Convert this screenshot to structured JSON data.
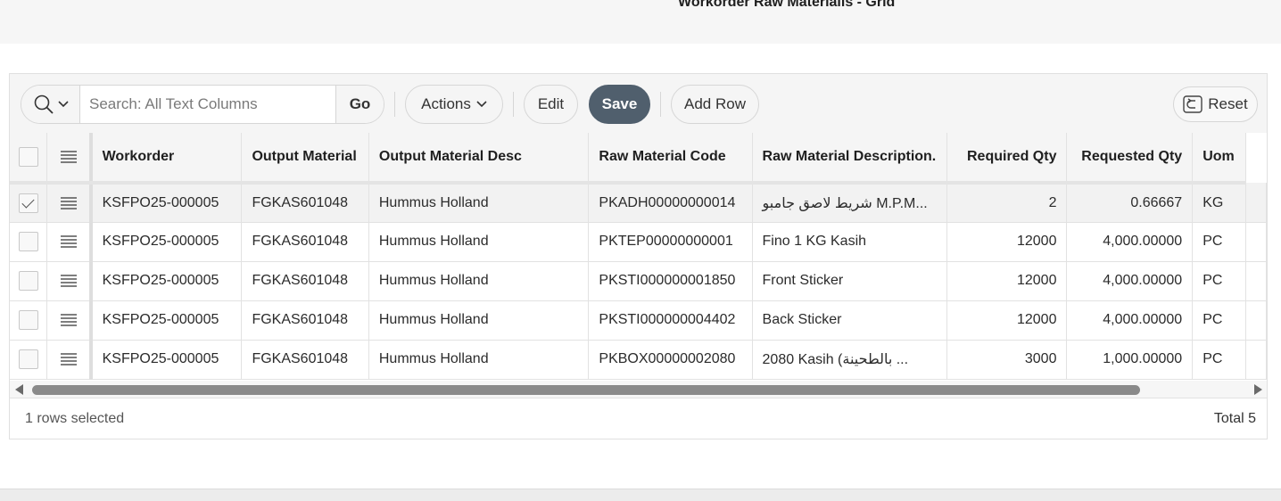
{
  "page": {
    "title": "Workorder Raw Materialis - Grid"
  },
  "toolbar": {
    "search_placeholder": "Search: All Text Columns",
    "go_label": "Go",
    "actions_label": "Actions",
    "edit_label": "Edit",
    "save_label": "Save",
    "add_row_label": "Add Row",
    "reset_label": "Reset"
  },
  "grid": {
    "columns": [
      "Workorder",
      "Output Material",
      "Output Material Desc",
      "Raw Material Code",
      "Raw Material Description.",
      "Required Qty",
      "Requested Qty",
      "Uom"
    ],
    "rows": [
      {
        "selected": true,
        "cells": [
          "KSFPO25-000005",
          "FGKAS601048",
          "Hummus Holland",
          "PKADH00000000014",
          "شريط لاصق جامبو M.P.M...",
          "2",
          "0.66667",
          "KG"
        ]
      },
      {
        "selected": false,
        "cells": [
          "KSFPO25-000005",
          "FGKAS601048",
          "Hummus Holland",
          "PKTEP00000000001",
          "Fino 1 KG Kasih",
          "12000",
          "4,000.00000",
          "PC"
        ]
      },
      {
        "selected": false,
        "cells": [
          "KSFPO25-000005",
          "FGKAS601048",
          "Hummus Holland",
          "PKSTI000000001850",
          "Front Sticker",
          "12000",
          "4,000.00000",
          "PC"
        ]
      },
      {
        "selected": false,
        "cells": [
          "KSFPO25-000005",
          "FGKAS601048",
          "Hummus Holland",
          "PKSTI000000004402",
          "Back Sticker",
          "12000",
          "4,000.00000",
          "PC"
        ]
      },
      {
        "selected": false,
        "cells": [
          "KSFPO25-000005",
          "FGKAS601048",
          "Hummus Holland",
          "PKBOX00000002080",
          "2080 Kasih  (بالطحينة ...",
          "3000",
          "1,000.00000",
          "PC"
        ]
      }
    ]
  },
  "footer": {
    "selection_text": "1 rows selected",
    "total_text": "Total 5"
  },
  "icons": {
    "search": "search-icon",
    "chevron": "chevron-down-icon",
    "reset": "reset-icon",
    "row_actions": "hamburger-icon"
  }
}
